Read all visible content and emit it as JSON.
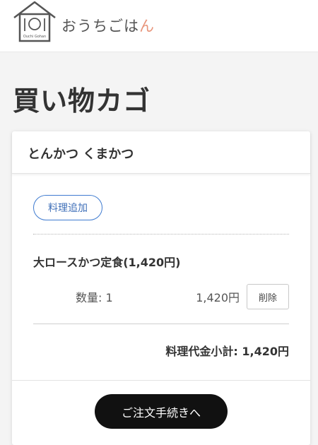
{
  "header": {
    "logo_brand_text": "Ouchi Gohan",
    "logo_text": "おうちごは",
    "logo_text_accent": "ん",
    "colors": {
      "accent": "#e8957b"
    }
  },
  "page": {
    "title": "買い物カゴ"
  },
  "cart": {
    "restaurant_name": "とんかつ くまかつ",
    "add_dish_label": "料理追加",
    "items": [
      {
        "name": "大ロースかつ定食(1,420円)",
        "quantity_text": "数量: 1",
        "line_price": "1,420円",
        "delete_label": "削除"
      }
    ],
    "subtotal_text": "料理代金小計: 1,420円",
    "checkout_label": "ご注文手続きへ",
    "colors": {
      "outline_blue": "#3f7bd0",
      "checkout_bg": "#111111"
    }
  }
}
